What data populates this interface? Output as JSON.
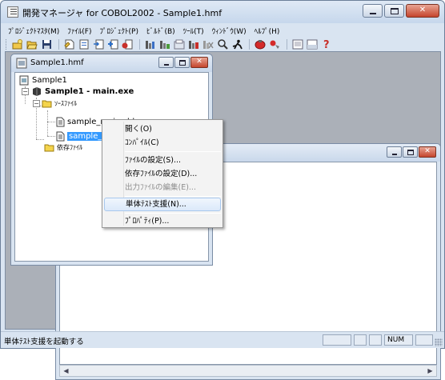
{
  "window": {
    "title": "開発マネージャ for COBOL2002 - Sample1.hmf"
  },
  "menubar": [
    "ﾌﾟﾛｼﾞｪｸﾄﾏｽﾀ(M)",
    "ﾌｧｲﾙ(F)",
    "ﾌﾟﾛｼﾞｪｸﾄ(P)",
    "ﾋﾞﾙﾄﾞ(B)",
    "ﾂｰﾙ(T)",
    "ｳｨﾝﾄﾞｳ(W)",
    "ﾍﾙﾌﾟ(H)"
  ],
  "toolbar": {
    "icons": [
      "new-project-icon",
      "open-project-icon",
      "save-icon",
      "new-file-icon",
      "add-file-icon",
      "import-icon",
      "add-item-icon",
      "remove-item-icon",
      "build-icon",
      "rebuild-icon",
      "compile-icon",
      "build-all-icon",
      "clean-icon",
      "find-icon",
      "run-icon",
      "debug-icon",
      "test-icon",
      "view-list-icon",
      "view-detail-icon",
      "help-icon"
    ]
  },
  "project_window": {
    "title": "Sample1.hmf",
    "tree": {
      "root": "Sample1",
      "target": "Sample1 - main.exe",
      "source_folder": "ｿｰｽﾌｧｲﾙ",
      "files": [
        "sample_main.cbl",
        "sample_sub.cbl"
      ],
      "dependency_folder": "依存ﾌｧｲﾙ"
    }
  },
  "context_menu": {
    "items": [
      {
        "label": "開く(O)",
        "enabled": true
      },
      {
        "label": "ｺﾝﾊﾟｲﾙ(C)",
        "enabled": true
      },
      {
        "label": "ﾌｧｲﾙの設定(S)...",
        "enabled": true
      },
      {
        "label": "依存ﾌｧｲﾙの設定(D)...",
        "enabled": true
      },
      {
        "label": "出力ﾌｧｲﾙの編集(E)...",
        "enabled": false
      },
      {
        "label": "単体ﾃｽﾄ支援(N)...",
        "enabled": true,
        "highlighted": true
      },
      {
        "label": "ﾌﾟﾛﾊﾟﾃｨ(P)...",
        "enabled": true
      }
    ]
  },
  "statusbar": {
    "message": "単体ﾃｽﾄ支援を起動する",
    "num_indicator": "NUM"
  },
  "colors": {
    "selection": "#3399ff",
    "window_frame": "#d9e4f1",
    "mdi_background": "#abb0b8"
  }
}
